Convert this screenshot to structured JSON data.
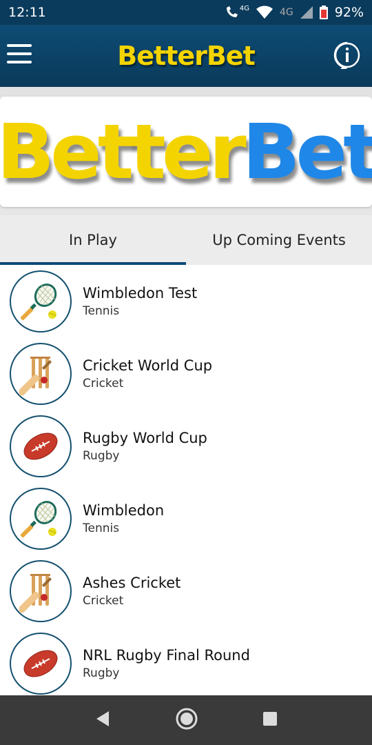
{
  "status_bar": {
    "time": "12:11",
    "network_label_1": "4G",
    "network_label_2": "4G",
    "battery": "92%",
    "icons": [
      "wifi-calling-icon",
      "wifi-icon",
      "signal-icon",
      "battery-icon"
    ]
  },
  "app_bar": {
    "logo_part1": "Better",
    "logo_part2": "Bet",
    "menu_icon": "menu-icon",
    "info_icon": "info-icon"
  },
  "banner": {
    "logo_part1": "Better",
    "logo_part2": "Bet"
  },
  "tabs": [
    {
      "label": "In Play",
      "active": true
    },
    {
      "label": "Up Coming Events",
      "active": false
    }
  ],
  "events": [
    {
      "title": "Wimbledon Test",
      "sport": "Tennis",
      "icon": "tennis-icon"
    },
    {
      "title": "Cricket World Cup",
      "sport": "Cricket",
      "icon": "cricket-icon"
    },
    {
      "title": "Rugby World Cup",
      "sport": "Rugby",
      "icon": "rugby-icon"
    },
    {
      "title": "Wimbledon",
      "sport": "Tennis",
      "icon": "tennis-icon"
    },
    {
      "title": "Ashes Cricket",
      "sport": "Cricket",
      "icon": "cricket-icon"
    },
    {
      "title": "NRL Rugby Final Round",
      "sport": "Rugby",
      "icon": "rugby-icon"
    }
  ],
  "nav_bar": {
    "icons": [
      "back-icon",
      "home-icon",
      "recents-icon"
    ]
  },
  "colors": {
    "app_bar": "#0e4b74",
    "logo_yellow": "#f4d400",
    "logo_blue": "#1f87e8",
    "tab_indicator": "#0b4a78"
  }
}
